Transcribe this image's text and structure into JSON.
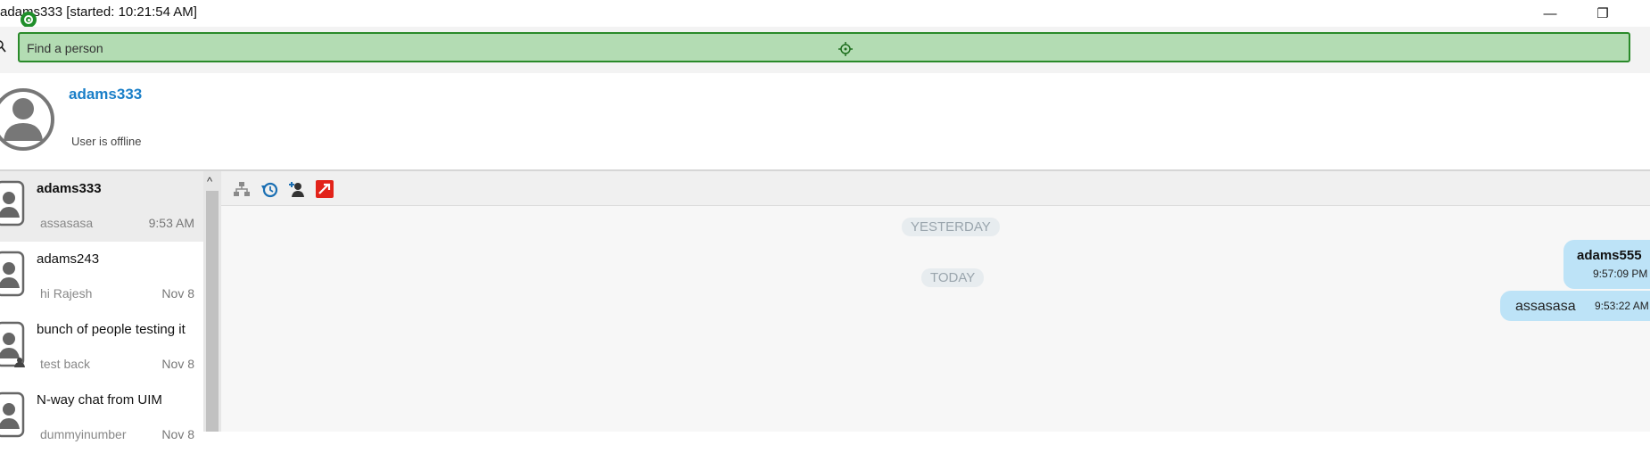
{
  "window": {
    "title": "adams333 [started: 10:21:54 AM]",
    "minimize_glyph": "—",
    "restore_glyph": "❐"
  },
  "search": {
    "placeholder": "Find a person"
  },
  "profile": {
    "name": "adams333",
    "status": "User is offline"
  },
  "conversations": [
    {
      "name": "adams333",
      "snippet": "assasasa",
      "time": "9:53 AM",
      "selected": true
    },
    {
      "name": "adams243",
      "snippet": "hi Rajesh",
      "time": "Nov 8"
    },
    {
      "name": "bunch of people testing it",
      "snippet": "test back",
      "time": "Nov 8"
    },
    {
      "name": "N-way chat from UIM",
      "snippet": "dummyinumber",
      "time": "Nov 8"
    }
  ],
  "toolbar_icons": [
    "org-chart-icon",
    "history-icon",
    "add-person-icon",
    "share-icon"
  ],
  "chat": {
    "separators": [
      "YESTERDAY",
      "TODAY"
    ],
    "messages": [
      {
        "sender": "adams555",
        "time": "9:57:09 PM"
      },
      {
        "text": "assasasa",
        "time": "9:53:22 AM"
      }
    ]
  },
  "colors": {
    "accent_name": "#1a7fc8",
    "bubble": "#bde3f7",
    "search_highlight": "#b3dcb3",
    "search_border": "#2a8a2a"
  }
}
